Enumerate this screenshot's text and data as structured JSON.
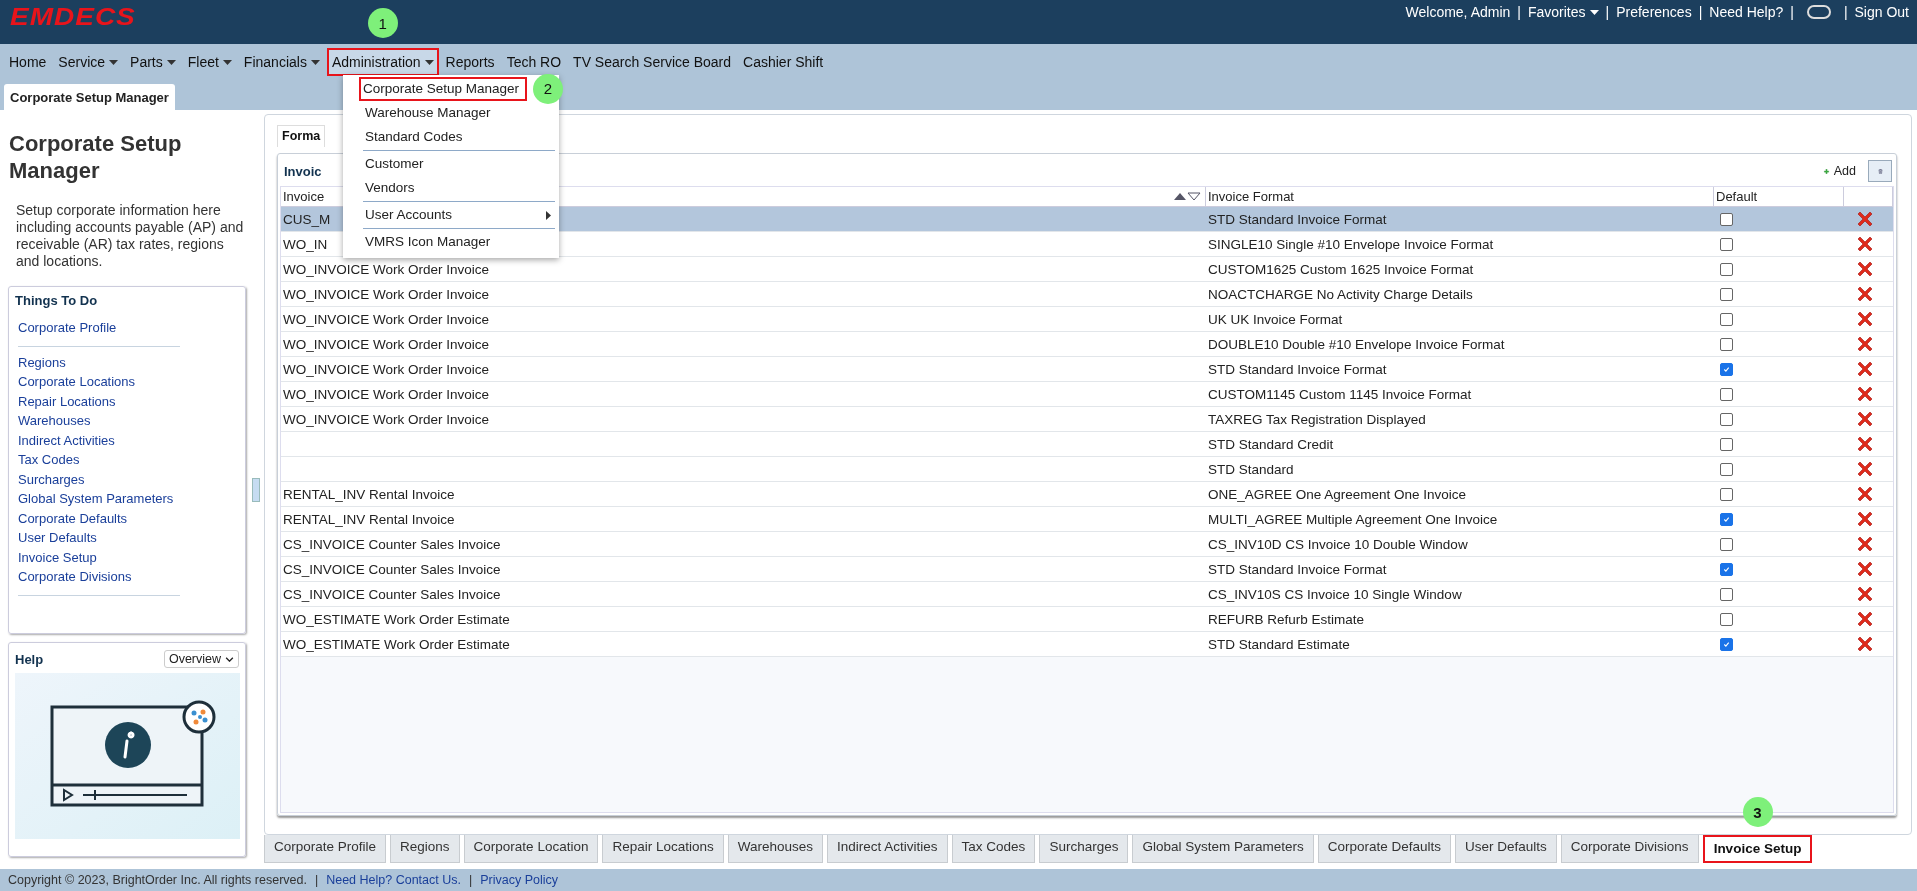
{
  "header": {
    "logo": "EMDECS",
    "divider": "|",
    "links": [
      {
        "kind": "text",
        "label": "Welcome, Admin"
      },
      {
        "kind": "menu",
        "label": "Favorites"
      },
      {
        "kind": "link",
        "label": "Preferences"
      },
      {
        "kind": "link",
        "label": "Need Help?"
      },
      {
        "kind": "toggle"
      },
      {
        "kind": "link",
        "label": "Sign Out"
      }
    ]
  },
  "nav": [
    {
      "label": "Home",
      "has_menu": false,
      "open": false
    },
    {
      "label": "Service",
      "has_menu": true,
      "open": false
    },
    {
      "label": "Parts",
      "has_menu": true,
      "open": false
    },
    {
      "label": "Fleet",
      "has_menu": true,
      "open": false
    },
    {
      "label": "Financials",
      "has_menu": true,
      "open": false
    },
    {
      "label": "Administration",
      "has_menu": true,
      "open": true,
      "highlighted": true,
      "callout": "1"
    },
    {
      "label": "Reports",
      "has_menu": false,
      "open": false
    },
    {
      "label": "Tech RO",
      "has_menu": false,
      "open": false
    },
    {
      "label": "TV Search Service Board",
      "has_menu": false,
      "open": false
    },
    {
      "label": "Cashier Shift",
      "has_menu": false,
      "open": false
    }
  ],
  "menu": [
    {
      "kind": "item",
      "label": "Corporate Setup Manager",
      "highlighted": true,
      "callout": "2"
    },
    {
      "kind": "item",
      "label": "Warehouse Manager"
    },
    {
      "kind": "item",
      "label": "Standard Codes"
    },
    {
      "kind": "separator"
    },
    {
      "kind": "item",
      "label": "Customer"
    },
    {
      "kind": "item",
      "label": "Vendors"
    },
    {
      "kind": "separator"
    },
    {
      "kind": "submenu",
      "label": "User Accounts"
    },
    {
      "kind": "separator"
    },
    {
      "kind": "item",
      "label": "VMRS Icon Manager"
    }
  ],
  "page_tabs": [
    {
      "label": "Corporate Setup Manager",
      "selected": true
    }
  ],
  "sidebar": {
    "title": "Corporate Setup Manager",
    "description": "Setup corporate information here including accounts payable (AP) and receivable (AR) tax rates, regions and locations.",
    "todo": {
      "title": "Things To Do",
      "groups": [
        [
          "Corporate Profile"
        ],
        [
          "Regions",
          "Corporate Locations",
          "Repair Locations",
          "Warehouses",
          "Indirect Activities",
          "Tax Codes",
          "Surcharges",
          "Global System Parameters",
          "Corporate Defaults",
          "User Defaults",
          "Invoice Setup",
          "Corporate Divisions"
        ]
      ]
    },
    "help": {
      "title": "Help",
      "dropdown": "Overview"
    }
  },
  "content": {
    "tab": "Forma",
    "panel_title": "Invoic",
    "add_label": "Add",
    "columns": [
      {
        "label": "Invoice",
        "sortable": true
      },
      {
        "label": "Invoice Format",
        "sortable": false
      },
      {
        "label": "Default",
        "sortable": false
      }
    ],
    "rows": [
      {
        "invoice": "CUS_M",
        "format": "STD Standard Invoice Format",
        "default": false,
        "selected": true
      },
      {
        "invoice": "WO_IN",
        "format": "SINGLE10 Single #10 Envelope Invoice Format",
        "default": false,
        "selected": false
      },
      {
        "invoice": "WO_INVOICE Work Order Invoice",
        "format": "CUSTOM1625 Custom 1625 Invoice Format",
        "default": false,
        "selected": false
      },
      {
        "invoice": "WO_INVOICE Work Order Invoice",
        "format": "NOACTCHARGE No Activity Charge Details",
        "default": false,
        "selected": false
      },
      {
        "invoice": "WO_INVOICE Work Order Invoice",
        "format": "UK UK Invoice Format",
        "default": false,
        "selected": false
      },
      {
        "invoice": "WO_INVOICE Work Order Invoice",
        "format": "DOUBLE10 Double #10 Envelope Invoice Format",
        "default": false,
        "selected": false
      },
      {
        "invoice": "WO_INVOICE Work Order Invoice",
        "format": "STD Standard Invoice Format",
        "default": true,
        "selected": false
      },
      {
        "invoice": "WO_INVOICE Work Order Invoice",
        "format": "CUSTOM1145 Custom 1145 Invoice Format",
        "default": false,
        "selected": false
      },
      {
        "invoice": "WO_INVOICE Work Order Invoice",
        "format": "TAXREG Tax Registration Displayed",
        "default": false,
        "selected": false
      },
      {
        "format": "STD Standard Credit",
        "default": false,
        "selected": false
      },
      {
        "format": "STD Standard",
        "default": false,
        "selected": false
      },
      {
        "invoice": "RENTAL_INV Rental Invoice",
        "format": "ONE_AGREE One Agreement One Invoice",
        "default": false,
        "selected": false
      },
      {
        "invoice": "RENTAL_INV Rental Invoice",
        "format": "MULTI_AGREE Multiple Agreement One Invoice",
        "default": true,
        "selected": false
      },
      {
        "invoice": "CS_INVOICE Counter Sales Invoice",
        "format": "CS_INV10D CS Invoice 10 Double Window",
        "default": false,
        "selected": false
      },
      {
        "invoice": "CS_INVOICE Counter Sales Invoice",
        "format": "STD Standard Invoice Format",
        "default": true,
        "selected": false
      },
      {
        "invoice": "CS_INVOICE Counter Sales Invoice",
        "format": "CS_INV10S CS Invoice 10 Single Window",
        "default": false,
        "selected": false
      },
      {
        "invoice": "WO_ESTIMATE Work Order Estimate",
        "format": "REFURB Refurb Estimate",
        "default": false,
        "selected": false
      },
      {
        "invoice": "WO_ESTIMATE Work Order Estimate",
        "format": "STD Standard Estimate",
        "default": true,
        "selected": false
      }
    ]
  },
  "bottom_tabs": [
    {
      "label": "Corporate Profile",
      "selected": false
    },
    {
      "label": "Regions",
      "selected": false
    },
    {
      "label": "Corporate Location",
      "selected": false
    },
    {
      "label": "Repair Locations",
      "selected": false
    },
    {
      "label": "Warehouses",
      "selected": false
    },
    {
      "label": "Indirect Activities",
      "selected": false
    },
    {
      "label": "Tax Codes",
      "selected": false
    },
    {
      "label": "Surcharges",
      "selected": false
    },
    {
      "label": "Global System Parameters",
      "selected": false
    },
    {
      "label": "Corporate Defaults",
      "selected": false
    },
    {
      "label": "User Defaults",
      "selected": false
    },
    {
      "label": "Corporate Divisions",
      "selected": false
    },
    {
      "label": "Invoice Setup",
      "selected": true,
      "highlighted": true,
      "callout": "3"
    }
  ],
  "footer": {
    "copyright": "Copyright © 2023, BrightOrder Inc. All rights reserved.",
    "divider": "|",
    "links": [
      "Need Help? Contact Us.",
      "Privacy Policy"
    ]
  }
}
